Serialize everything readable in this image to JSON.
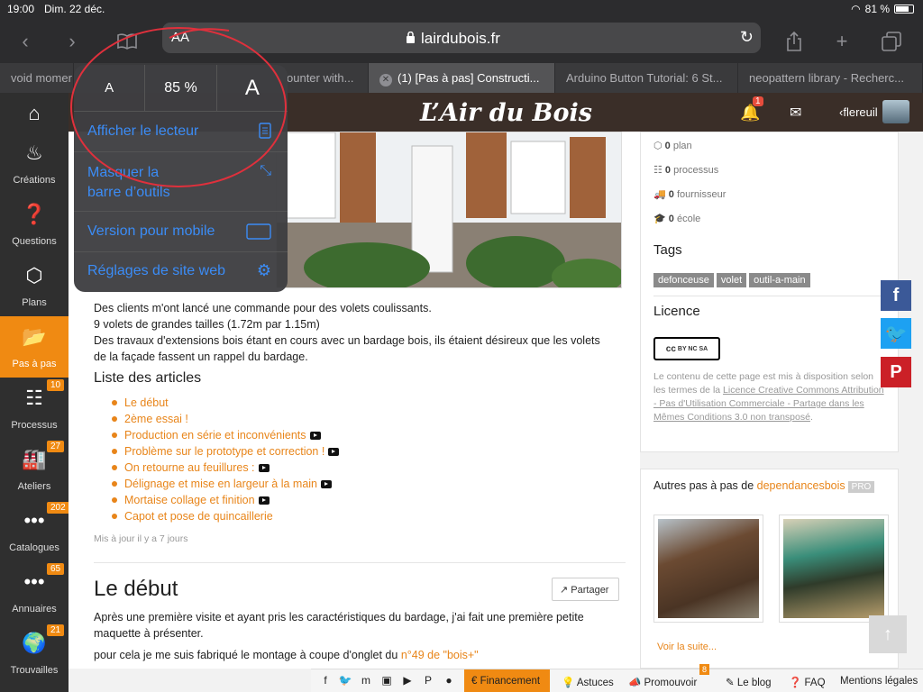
{
  "status": {
    "time": "19:00",
    "date": "Dim. 22 déc.",
    "battery": "81 %"
  },
  "browser": {
    "text_size_button": "AA",
    "url": "lairdubois.fr",
    "tabs": [
      {
        "title": "void momer"
      },
      {
        "title": "ounter with..."
      },
      {
        "title": "(1) [Pas à pas] Constructi..."
      },
      {
        "title": "Arduino Button Tutorial: 6 St..."
      },
      {
        "title": "neopattern library - Recherc..."
      }
    ],
    "icons": {
      "back": "chevron-left-icon",
      "forward": "chevron-right-icon",
      "bookmarks": "book-icon",
      "reload": "reload-icon",
      "share": "share-icon",
      "new_tab": "plus-icon",
      "tabs": "tabs-icon"
    }
  },
  "popover": {
    "font_small": "A",
    "zoom": "85 %",
    "font_large": "A",
    "items": [
      {
        "label": "Afficher le lecteur",
        "icon": "reader-icon"
      },
      {
        "label": "Masquer la\nbarre d’outils",
        "icon": "expand-arrows-icon"
      },
      {
        "label": "Version pour mobile",
        "icon": "desktop-icon"
      },
      {
        "label": "Réglages de site web",
        "icon": "gear-icon"
      }
    ]
  },
  "site": {
    "logo": "L’Air du Bois",
    "notifications_count": "1",
    "username": "flereuil"
  },
  "sidebar": [
    {
      "label": "",
      "icon": "home-icon"
    },
    {
      "label": "Créations",
      "icon": "fire-icon"
    },
    {
      "label": "Questions",
      "icon": "question-icon"
    },
    {
      "label": "Plans",
      "icon": "cube-icon"
    },
    {
      "label": "Pas à pas",
      "icon": "folder-open-icon",
      "active": true
    },
    {
      "label": "Processus",
      "icon": "sitemap-icon",
      "count": "10"
    },
    {
      "label": "Ateliers",
      "icon": "factory-icon",
      "count": "27"
    },
    {
      "label": "Catalogues",
      "icon": "dots-icon",
      "count": "202"
    },
    {
      "label": "Annuaires",
      "icon": "dots-icon",
      "count": "65"
    },
    {
      "label": "Trouvailles",
      "icon": "globe-icon",
      "count": "21"
    }
  ],
  "article": {
    "intro": [
      "Des clients m'ont lancé une commande pour des volets coulissants.",
      "9 volets de grandes tailles (1.72m par 1.15m)",
      "Des travaux d'extensions bois étant en cours avec un bardage bois, ils étaient désireux que les volets",
      "de la façade fassent un rappel du bardage."
    ],
    "list_title": "Liste des articles",
    "list": [
      {
        "label": "Le début",
        "video": false
      },
      {
        "label": "2ème essai !",
        "video": false
      },
      {
        "label": "Production en série et inconvénients",
        "video": true
      },
      {
        "label": "Problème sur le prototype et correction !",
        "video": true
      },
      {
        "label": "On retourne au feuillures :",
        "video": true
      },
      {
        "label": "Délignage et mise en largeur à la main",
        "video": true
      },
      {
        "label": "Mortaise collage et finition",
        "video": true
      },
      {
        "label": "Capot et pose de quincaillerie",
        "video": false
      }
    ],
    "updated": "Mis à jour il y a 7 jours",
    "section_title": "Le début",
    "share_label": "Partager",
    "body": "Après une première visite et ayant pris les caractéristiques du bardage, j'ai fait une première petite maquette à présenter.",
    "body3_prefix": "pour cela je me suis fabriqué le montage à coupe d'onglet du ",
    "body3_link": "n°49 de \"bois+\""
  },
  "right": {
    "stats": [
      {
        "value": "0",
        "label": "plan"
      },
      {
        "value": "0",
        "label": "processus"
      },
      {
        "value": "0",
        "label": "fournisseur"
      },
      {
        "value": "0",
        "label": "école"
      }
    ],
    "tags_title": "Tags",
    "tags": [
      "defonceuse",
      "volet",
      "outil-a-main"
    ],
    "licence_title": "Licence",
    "licence_badge": "BY NC SA",
    "licence_text_1": "Le contenu de cette page est mis à disposition selon les termes de la ",
    "licence_link": "Licence Creative Commons Attribution - Pas d'Utilisation Commerciale - Partage dans les Mêmes Conditions 3.0 non transposé",
    "licence_text_2": ".",
    "other_prefix": "Autres pas à pas de ",
    "other_author": "dependancesbois",
    "other_badge": "PRO",
    "see_more": "Voir la suite..."
  },
  "social": {
    "facebook": "f",
    "twitter": "twitter-bird-icon",
    "pinterest": "P"
  },
  "footer": {
    "financement": "Financement",
    "astuces": "Astuces",
    "promouvoir": "Promouvoir",
    "promouvoir_badge": "8",
    "blog": "Le blog",
    "faq": "FAQ",
    "mentions": "Mentions légales"
  }
}
